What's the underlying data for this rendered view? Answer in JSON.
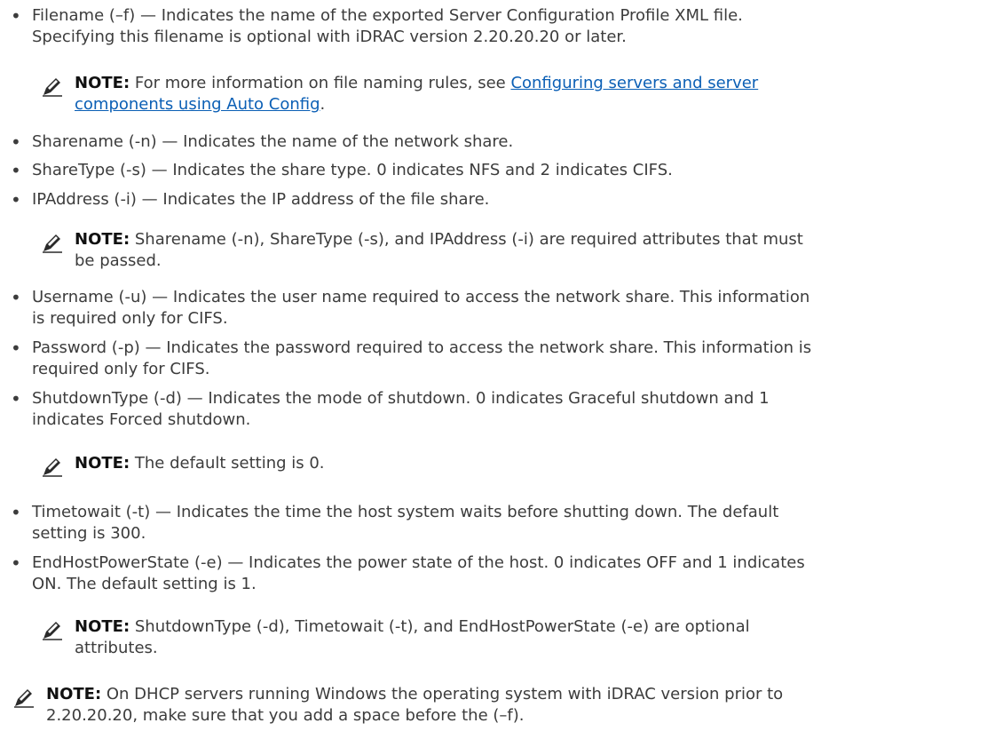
{
  "bullets": [
    {
      "line1": "Filename (–f) — Indicates the name of the exported Server Configuration Profile XML file.",
      "line2": "Specifying this filename is optional with iDRAC version 2.20.20.20 or later."
    },
    {
      "line1": "Sharename (-n) — Indicates the name of the network share."
    },
    {
      "line1": "ShareType (-s) — Indicates the share type. 0 indicates NFS and 2 indicates CIFS."
    },
    {
      "line1": "IPAddress (-i) — Indicates the IP address of the file share."
    },
    {
      "line1": "Username (-u) — Indicates the user name required to access the network share. This information",
      "line2": "is required only for CIFS."
    },
    {
      "line1": "Password (-p) — Indicates the password required to access the network share. This information is",
      "line2": "required only for CIFS."
    },
    {
      "line1": "ShutdownType (-d) — Indicates the mode of shutdown. 0 indicates Graceful shutdown and 1",
      "line2": "indicates Forced shutdown."
    },
    {
      "line1": "Timetowait (-t) — Indicates the time the host system waits before shutting down. The default",
      "line2": "setting is 300."
    },
    {
      "line1": "EndHostPowerState (-e) — Indicates the power state of the host. 0 indicates OFF and 1 indicates",
      "line2": "ON. The default setting is 1."
    }
  ],
  "bullet_char": "•",
  "note_label": "NOTE:",
  "notes": [
    {
      "prefix": "For more information on file naming rules, see ",
      "link_line1": "Configuring servers and server",
      "link_line2": "components using Auto Config",
      "suffix": "."
    },
    {
      "line1": "Sharename (-n), ShareType (-s), and IPAddress (-i) are required attributes that must",
      "line2": "be passed."
    },
    {
      "line1": "The default setting is 0."
    },
    {
      "line1": "ShutdownType (-d), Timetowait (-t), and EndHostPowerState (-e) are optional",
      "line2": "attributes."
    },
    {
      "line1": "On DHCP servers running Windows the operating system with iDRAC version prior to",
      "line2": "2.20.20.20, make sure that you add a space before the (–f)."
    }
  ],
  "colors": {
    "text": "#3c3c3c",
    "link": "#0b5fb5",
    "note_label": "#111111"
  }
}
